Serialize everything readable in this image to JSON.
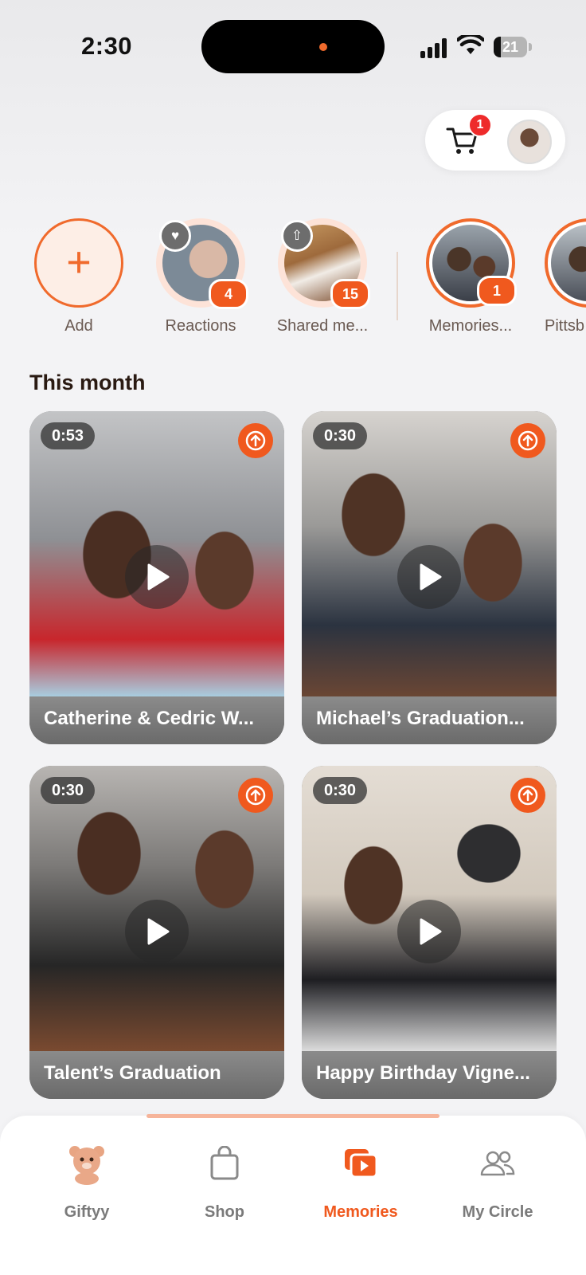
{
  "status_bar": {
    "time": "2:30",
    "battery": "21",
    "battery_level": 0.21
  },
  "header": {
    "cart_badge": "1"
  },
  "stories": [
    {
      "label": "Add"
    },
    {
      "label": "Reactions",
      "badge": "4"
    },
    {
      "label": "Shared me...",
      "badge": "15"
    },
    {
      "label": "Memories...",
      "badge": "1"
    },
    {
      "label": "Pittsb"
    }
  ],
  "section": {
    "title": "This month"
  },
  "memories": [
    {
      "duration": "0:53",
      "title": "Catherine & Cedric W..."
    },
    {
      "duration": "0:30",
      "title": "Michael’s Graduation..."
    },
    {
      "duration": "0:30",
      "title": "Talent’s Graduation"
    },
    {
      "duration": "0:30",
      "title": "Happy Birthday Vigne..."
    }
  ],
  "nav": {
    "items": [
      {
        "label": "Giftyy"
      },
      {
        "label": "Shop"
      },
      {
        "label": "Memories"
      },
      {
        "label": "My Circle"
      }
    ],
    "active": "Memories"
  },
  "colors": {
    "accent": "#f0591e",
    "badge_red": "#ee2b2b"
  }
}
